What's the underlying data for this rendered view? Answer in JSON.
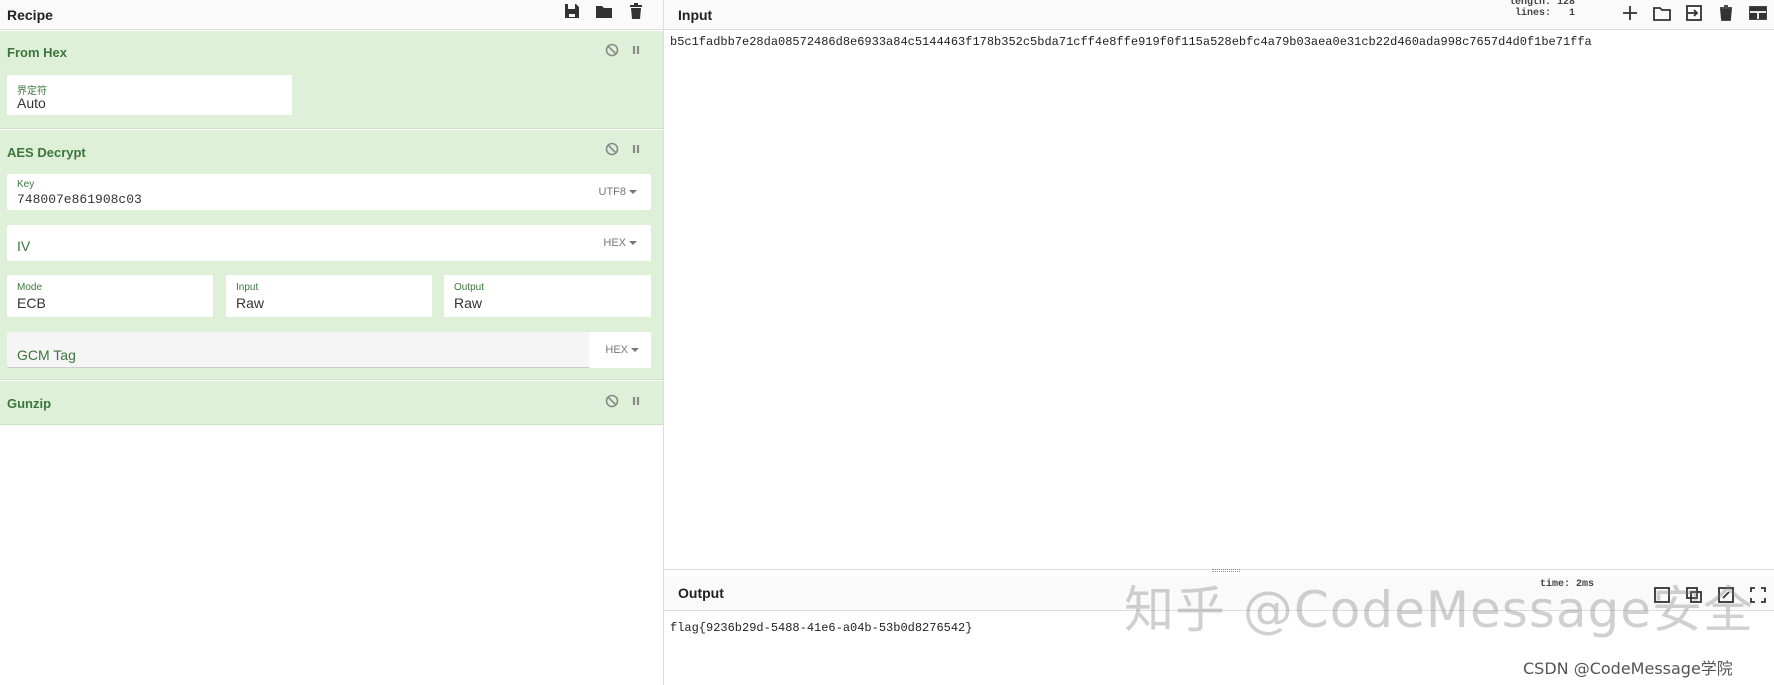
{
  "recipe": {
    "title": "Recipe",
    "operations": [
      {
        "name": "From Hex",
        "delimiter_label": "界定符",
        "delimiter_value": "Auto"
      },
      {
        "name": "AES Decrypt",
        "key_label": "Key",
        "key_value": "748007e861908c03",
        "key_encoding": "UTF8",
        "iv_placeholder": "IV",
        "iv_encoding": "HEX",
        "mode_label": "Mode",
        "mode_value": "ECB",
        "input_label": "Input",
        "input_value": "Raw",
        "output_label": "Output",
        "output_value": "Raw",
        "gcm_placeholder": "GCM Tag",
        "gcm_encoding": "HEX"
      },
      {
        "name": "Gunzip"
      }
    ]
  },
  "input": {
    "title": "Input",
    "length_label": "length:",
    "length_value": "128",
    "lines_label": "lines:",
    "lines_value": "1",
    "text": "b5c1fadbb7e28da08572486d8e6933a84c5144463f178b352c5bda71cff4e8ffe919f0f115a528ebfc4a79b03aea0e31cb22d460ada998c7657d4d0f1be71ffa"
  },
  "output": {
    "title": "Output",
    "time_label": "time:",
    "time_value": "2ms",
    "text": "flag{9236b29d-5488-41e6-a04b-53b0d8276542}"
  },
  "watermarks": {
    "zhihu": "知乎 @CodeMessage安全",
    "csdn": "CSDN @CodeMessage学院"
  }
}
